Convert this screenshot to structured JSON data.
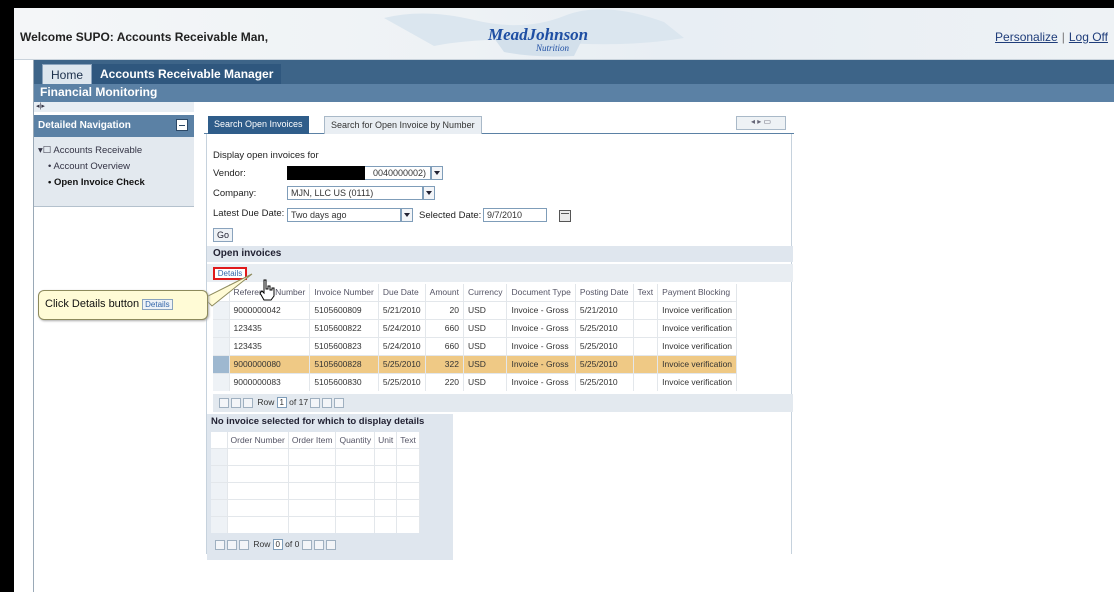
{
  "header": {
    "welcome": "Welcome SUPO: Accounts Receivable Man,",
    "logo_main": "MeadJohnson",
    "logo_sub": "Nutrition",
    "personalize": "Personalize",
    "separator": "|",
    "logoff": "Log Off"
  },
  "tabs": {
    "home": "Home",
    "arm": "Accounts Receivable Manager"
  },
  "subnav": {
    "title": "Financial Monitoring"
  },
  "nav": {
    "mini": "◂|▸",
    "title": "Detailed Navigation",
    "root": "▾☐ Accounts Receivable",
    "items": [
      "• Account Overview",
      "• Open Invoice Check"
    ]
  },
  "main_tabs": [
    "Search Open Invoices",
    "Search for Open Invoice by Number"
  ],
  "form": {
    "heading": "Display open invoices for",
    "vendor_label": "Vendor:",
    "vendor_value": "0040000002)",
    "company_label": "Company:",
    "company_value": "MJN, LLC US (0111)",
    "due_label": "Latest Due Date:",
    "due_value": "Two days ago",
    "selected_label": "Selected Date:",
    "selected_value": "9/7/2010",
    "go": "Go"
  },
  "open_invoices": {
    "title": "Open invoices",
    "details_button": "Details",
    "columns": [
      "Reference Number",
      "Invoice Number",
      "Due Date",
      "Amount",
      "Currency",
      "Document Type",
      "Posting Date",
      "Text",
      "Payment Blocking"
    ],
    "rows": [
      [
        "9000000042",
        "5105600809",
        "5/21/2010",
        "20",
        "USD",
        "Invoice - Gross",
        "5/21/2010",
        "",
        "Invoice verification"
      ],
      [
        "123435",
        "5105600822",
        "5/24/2010",
        "660",
        "USD",
        "Invoice - Gross",
        "5/25/2010",
        "",
        "Invoice verification"
      ],
      [
        "123435",
        "5105600823",
        "5/24/2010",
        "660",
        "USD",
        "Invoice - Gross",
        "5/25/2010",
        "",
        "Invoice verification"
      ],
      [
        "9000000080",
        "5105600828",
        "5/25/2010",
        "322",
        "USD",
        "Invoice - Gross",
        "5/25/2010",
        "",
        "Invoice verification"
      ],
      [
        "9000000083",
        "5105600830",
        "5/25/2010",
        "220",
        "USD",
        "Invoice - Gross",
        "5/25/2010",
        "",
        "Invoice verification"
      ]
    ],
    "highlight_row": 3,
    "pager": {
      "row_label": "Row",
      "row_value": "1",
      "of_text": "of 17"
    }
  },
  "details": {
    "title": "No invoice selected for which to display details",
    "columns": [
      "Order Number",
      "Order Item",
      "Quantity",
      "Unit",
      "Text"
    ],
    "pager": {
      "row_label": "Row",
      "row_value": "0",
      "of_text": "of 0"
    }
  },
  "callout": {
    "text": "Click Details button",
    "button": "Details"
  },
  "colors": {
    "header_blue": "#3d6488",
    "highlight": "#efc985",
    "callout_bg": "#fffbd6",
    "focus_red": "#e0191b"
  }
}
